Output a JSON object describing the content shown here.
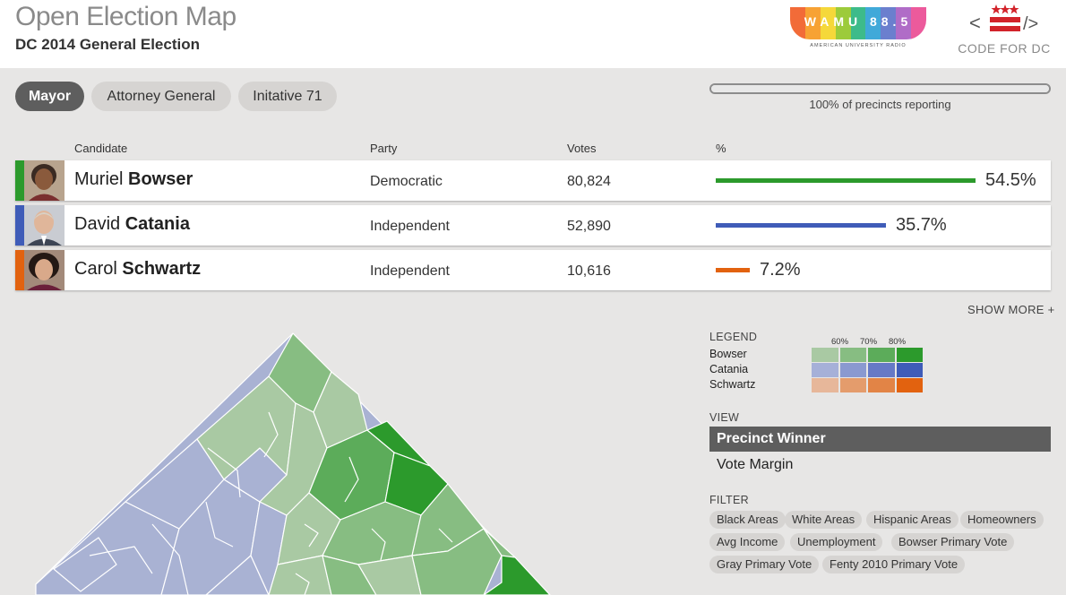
{
  "header": {
    "title": "Open Election Map",
    "subtitle": "DC 2014 General Election",
    "wamu_logo": {
      "text": "WAMU 88.5",
      "subtext": "AMERICAN UNIVERSITY RADIO",
      "colors": [
        "#f26b38",
        "#f7a234",
        "#f5d83a",
        "#9ccb3b",
        "#3dbb8a",
        "#40a9d9",
        "#6b7fce",
        "#b06cc7",
        "#ec5a9c"
      ]
    },
    "cfdc_logo": {
      "text": "CODE FOR DC",
      "red": "#d2232a"
    }
  },
  "tabs": [
    {
      "label": "Mayor",
      "active": true
    },
    {
      "label": "Attorney General",
      "active": false
    },
    {
      "label": "Initative 71",
      "active": false
    }
  ],
  "progress": {
    "label": "100% of precincts reporting",
    "value": 1.0
  },
  "table": {
    "headers": {
      "candidate": "Candidate",
      "party": "Party",
      "votes": "Votes",
      "pct": "%"
    },
    "rows": [
      {
        "first": "Muriel",
        "last": "Bowser",
        "party": "Democratic",
        "votes": "80,824",
        "pct": "54.5%",
        "share": 0.545,
        "color": "#2c9a2c"
      },
      {
        "first": "David",
        "last": "Catania",
        "party": "Independent",
        "votes": "52,890",
        "pct": "35.7%",
        "share": 0.357,
        "color": "#3f5cb8"
      },
      {
        "first": "Carol",
        "last": "Schwartz",
        "party": "Independent",
        "votes": "10,616",
        "pct": "7.2%",
        "share": 0.072,
        "color": "#e2620f"
      }
    ],
    "show_more": "SHOW MORE +"
  },
  "legend": {
    "heading": "LEGEND",
    "ticks": [
      "60%",
      "70%",
      "80%"
    ],
    "rows": [
      {
        "label": "Bowser",
        "colors": [
          "#a9c9a3",
          "#87bd82",
          "#5cac5a",
          "#2c9a2c"
        ]
      },
      {
        "label": "Catania",
        "colors": [
          "#a6b0d8",
          "#8a99d0",
          "#6679c6",
          "#3f5cb8"
        ]
      },
      {
        "label": "Schwartz",
        "colors": [
          "#e7b79a",
          "#e49c6c",
          "#e28446",
          "#e2620f"
        ]
      }
    ]
  },
  "view": {
    "heading": "VIEW",
    "options": [
      {
        "label": "Precinct Winner",
        "active": true
      },
      {
        "label": "Vote Margin",
        "active": false
      }
    ]
  },
  "filter": {
    "heading": "FILTER",
    "pills": [
      "Black Areas",
      "White Areas",
      "Hispanic Areas",
      "Homeowners",
      "Avg Income",
      "Unemployment",
      "Bowser Primary Vote",
      "Gray Primary Vote",
      "Fenty 2010 Primary Vote"
    ]
  }
}
